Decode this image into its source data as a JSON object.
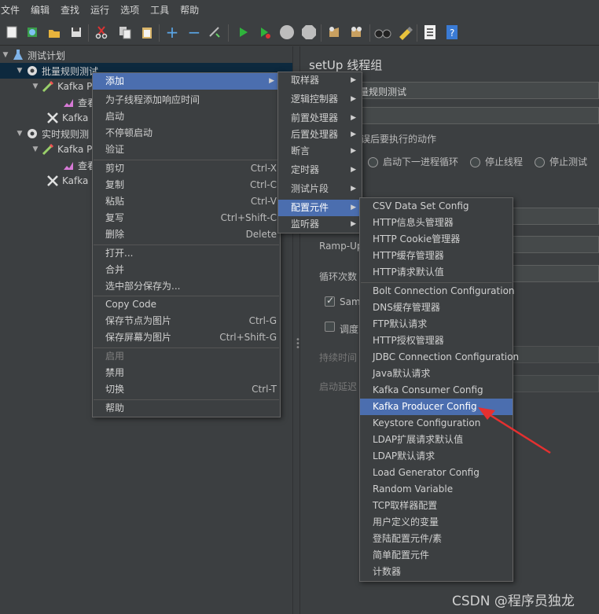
{
  "menubar": [
    "文件",
    "编辑",
    "查找",
    "运行",
    "选项",
    "工具",
    "帮助"
  ],
  "toolbar": {
    "icons": [
      "new-icon",
      "templates-icon",
      "open-icon",
      "save-icon",
      "cut-icon",
      "copy-icon",
      "paste-icon",
      "expand-icon",
      "collapse-icon",
      "toggle-icon",
      "start-icon",
      "start-no-pause-icon",
      "stop-icon",
      "shutdown-icon",
      "clear-icon",
      "clear-all-icon",
      "search-icon",
      "reset-search-icon",
      "function-helper-icon",
      "help-icon"
    ]
  },
  "tree": {
    "items": [
      {
        "label": "测试计划",
        "icon": "flask-icon"
      },
      {
        "label": "批量规则测试",
        "icon": "gear-icon"
      },
      {
        "label": "Kafka P",
        "icon": "pipette-icon"
      },
      {
        "label": "查看",
        "icon": "graph-icon"
      },
      {
        "label": "Kafka P",
        "icon": "tools-icon"
      },
      {
        "label": "实时规则测",
        "icon": "gear-icon"
      },
      {
        "label": "Kafka P",
        "icon": "pipette-icon"
      },
      {
        "label": "查看",
        "icon": "graph-icon"
      },
      {
        "label": "Kafka P",
        "icon": "tools-icon"
      }
    ]
  },
  "panel": {
    "title": "setUp 线程组",
    "name_value": "量规则测试",
    "error_action_label": "误后要执行的动作",
    "radio_next_loop": "启动下一进程循环",
    "radio_stop_thread": "停止线程",
    "radio_stop_test": "停止测试",
    "rampup_label": "Ramp-Up",
    "loop_label": "循环次数",
    "same_user_label": "Sam",
    "scheduler_label": "调度",
    "duration_label": "持续时间",
    "delay_label": "启动延迟"
  },
  "context_menu": {
    "items": [
      {
        "label": "添加",
        "submenu": true
      },
      {
        "label": "为子线程添加响应时间"
      },
      {
        "label": "启动"
      },
      {
        "label": "不停顿启动"
      },
      {
        "label": "验证"
      },
      {
        "label": "剪切",
        "shortcut": "Ctrl-X"
      },
      {
        "label": "复制",
        "shortcut": "Ctrl-C"
      },
      {
        "label": "粘贴",
        "shortcut": "Ctrl-V"
      },
      {
        "label": "复写",
        "shortcut": "Ctrl+Shift-C"
      },
      {
        "label": "删除",
        "shortcut": "Delete"
      },
      {
        "label": "打开..."
      },
      {
        "label": "合并"
      },
      {
        "label": "选中部分保存为..."
      },
      {
        "label": "Copy Code"
      },
      {
        "label": "保存节点为图片",
        "shortcut": "Ctrl-G"
      },
      {
        "label": "保存屏幕为图片",
        "shortcut": "Ctrl+Shift-G"
      },
      {
        "label": "启用"
      },
      {
        "label": "禁用"
      },
      {
        "label": "切换",
        "shortcut": "Ctrl-T"
      },
      {
        "label": "帮助"
      }
    ]
  },
  "add_submenu": {
    "items": [
      {
        "label": "取样器"
      },
      {
        "label": "逻辑控制器"
      },
      {
        "label": "前置处理器"
      },
      {
        "label": "后置处理器"
      },
      {
        "label": "断言"
      },
      {
        "label": "定时器"
      },
      {
        "label": "测试片段"
      },
      {
        "label": "配置元件"
      },
      {
        "label": "监听器"
      }
    ]
  },
  "config_submenu": {
    "items": [
      {
        "label": "CSV Data Set Config"
      },
      {
        "label": "HTTP信息头管理器"
      },
      {
        "label": "HTTP Cookie管理器"
      },
      {
        "label": "HTTP缓存管理器"
      },
      {
        "label": "HTTP请求默认值"
      },
      {
        "label": "Bolt Connection Configuration"
      },
      {
        "label": "DNS缓存管理器"
      },
      {
        "label": "FTP默认请求"
      },
      {
        "label": "HTTP授权管理器"
      },
      {
        "label": "JDBC Connection Configuration"
      },
      {
        "label": "Java默认请求"
      },
      {
        "label": "Kafka Consumer Config"
      },
      {
        "label": "Kafka Producer Config"
      },
      {
        "label": "Keystore Configuration"
      },
      {
        "label": "LDAP扩展请求默认值"
      },
      {
        "label": "LDAP默认请求"
      },
      {
        "label": "Load Generator Config"
      },
      {
        "label": "Random Variable"
      },
      {
        "label": "TCP取样器配置"
      },
      {
        "label": "用户定义的变量"
      },
      {
        "label": "登陆配置元件/素"
      },
      {
        "label": "简单配置元件"
      },
      {
        "label": "计数器"
      }
    ]
  },
  "watermark": "CSDN @程序员独龙",
  "colors": {
    "highlight": "#4b6eaf",
    "annotation_arrow": "#e53030",
    "background": "#3c3f41"
  }
}
